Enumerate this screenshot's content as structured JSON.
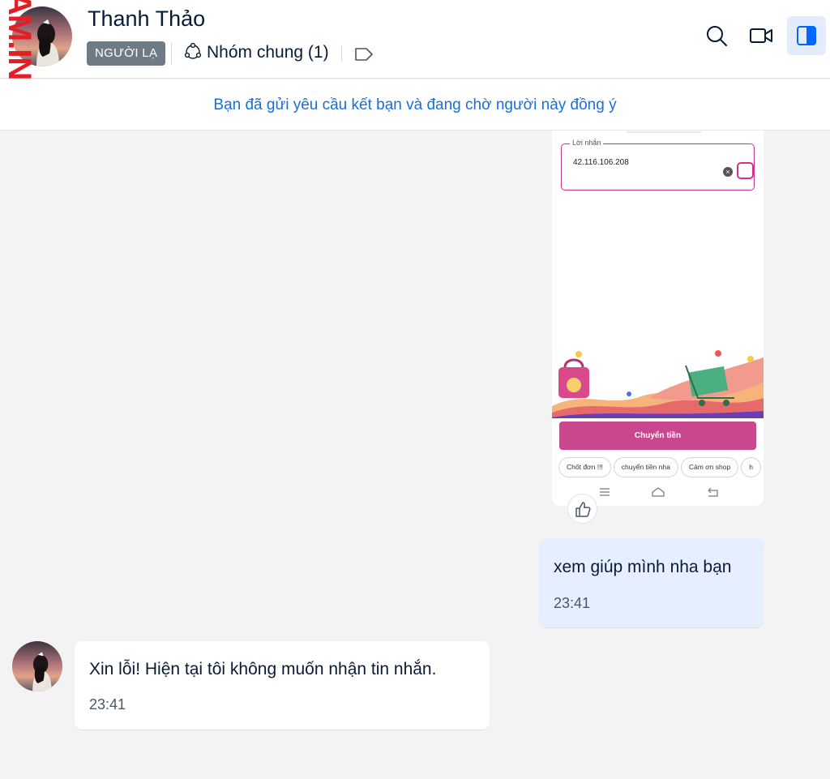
{
  "watermark": "AM.INFO",
  "header": {
    "contact_name": "Thanh Thảo",
    "stranger_badge": "NGƯỜI LẠ",
    "common_groups": "Nhóm chung (1)",
    "icons": [
      "group-icon",
      "tag-icon",
      "search-icon",
      "video-call-icon",
      "sidebar-toggle-icon"
    ]
  },
  "banner": {
    "text": "Bạn đã gửi yêu cầu kết bạn và đang chờ người này đồng ý"
  },
  "screenshot_message": {
    "field_label": "Lời nhắn",
    "field_value": "42.116.106.208",
    "primary_button": "Chuyển tiền",
    "chips": [
      "Chốt đơn !!!",
      "chuyển tiền nha",
      "Cảm ơn shop",
      "h"
    ]
  },
  "messages": [
    {
      "from": "me",
      "text": "xem giúp mình nha bạn",
      "time": "23:41"
    },
    {
      "from": "them",
      "text": "Xin lỗi! Hiện tại tôi không muốn nhận tin nhắn.",
      "time": "23:41"
    }
  ],
  "colors": {
    "link_blue": "#1a6fd6",
    "sent_bubble": "#e5efff",
    "badge_grey": "#6f7a87",
    "cta_pink": "#c9478d",
    "watermark_red": "#e31e24"
  }
}
